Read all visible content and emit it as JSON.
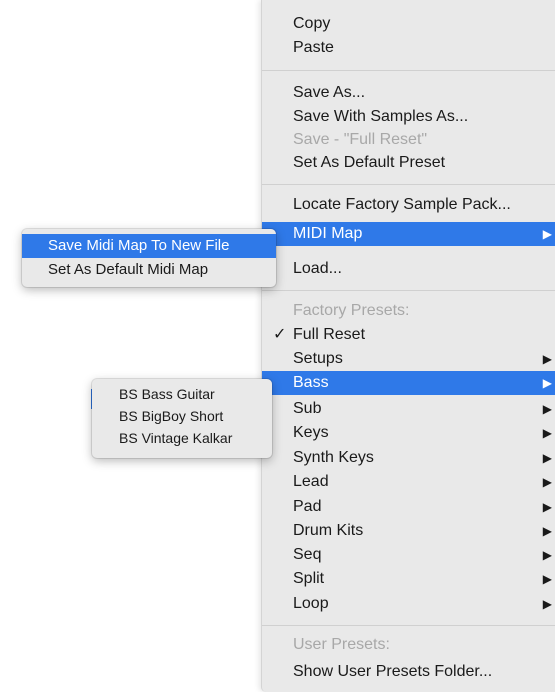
{
  "main_menu": {
    "copy": "Copy",
    "paste": "Paste",
    "save_as": "Save As...",
    "save_with_samples": "Save With Samples As...",
    "save_full_reset": "Save - \"Full Reset\"",
    "set_default_preset": "Set As Default Preset",
    "locate_factory": "Locate Factory Sample Pack...",
    "midi_map": "MIDI Map",
    "load": "Load...",
    "factory_presets_header": "Factory Presets:",
    "full_reset": "Full Reset",
    "full_reset_check": "✓",
    "setups": "Setups",
    "bass": "Bass",
    "sub": "Sub",
    "keys": "Keys",
    "synth_keys": "Synth Keys",
    "lead": "Lead",
    "pad": "Pad",
    "drum_kits": "Drum Kits",
    "seq": "Seq",
    "split": "Split",
    "loop": "Loop",
    "user_presets_header": "User Presets:",
    "show_user_presets": "Show User Presets Folder...",
    "arrow_glyph": "▶"
  },
  "midi_submenu": {
    "save_midi_map": "Save Midi Map To New File",
    "set_default_midi_map": "Set As Default Midi Map"
  },
  "bass_submenu": {
    "items": [
      "BS Bass Guitar",
      "BS BigBoy Short",
      "BS Vintage Kalkar"
    ]
  },
  "colors": {
    "highlight": "#2f79e8",
    "menu_bg": "#e9e9e9",
    "disabled_text": "#a8a8a8"
  }
}
